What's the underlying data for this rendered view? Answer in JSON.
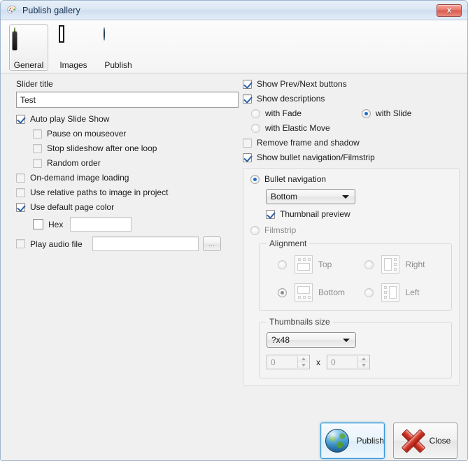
{
  "window": {
    "title": "Publish gallery",
    "title_icon": "gallery-palette-icon",
    "close_label": "x"
  },
  "tabs": [
    {
      "label": "General",
      "icon": "info-circle-icon",
      "selected": true
    },
    {
      "label": "Images",
      "icon": "photo-icon",
      "selected": false
    },
    {
      "label": "Publish",
      "icon": "globe-icon",
      "selected": false
    }
  ],
  "left": {
    "slider_title_label": "Slider title",
    "slider_title_value": "Test",
    "slider_title_placeholder": "",
    "auto_play": "Auto play Slide Show",
    "pause_on_mouseover": "Pause on mouseover",
    "stop_after_loop": "Stop slideshow after one loop",
    "random_order": "Random order",
    "on_demand": "On-demand image loading",
    "relative_paths": "Use relative paths to image in project",
    "default_page_color": "Use default page color",
    "hex_label": "Hex",
    "hex_value": "",
    "play_audio": "Play audio file",
    "audio_path_value": "",
    "browse_label": "..."
  },
  "right": {
    "show_prev_next": "Show Prev/Next buttons",
    "show_descriptions": "Show descriptions",
    "with_fade": "with Fade",
    "with_slide": "with Slide",
    "with_elastic": "with Elastic Move",
    "remove_frame": "Remove frame and shadow",
    "show_bullet_nav": "Show bullet navigation/Filmstrip",
    "bullet_navigation": "Bullet navigation",
    "bullet_position_value": "Bottom",
    "thumbnail_preview": "Thumbnail preview",
    "filmstrip": "Filmstrip",
    "alignment_title": "Alignment",
    "align_top": "Top",
    "align_right": "Right",
    "align_bottom": "Bottom",
    "align_left": "Left",
    "thumbnails_size_title": "Thumbnails size",
    "thumbnails_size_value": "?x48",
    "thumb_width_value": "0",
    "thumb_sep": "x",
    "thumb_height_value": "0"
  },
  "footer": {
    "publish_label": "Publish",
    "close_label": "Close"
  },
  "colors": {
    "accent_blue": "#1c6fc4",
    "titlebar": "#dbe7f3",
    "dialog_bg": "#f0f0f0",
    "close_red": "#d9584c"
  }
}
